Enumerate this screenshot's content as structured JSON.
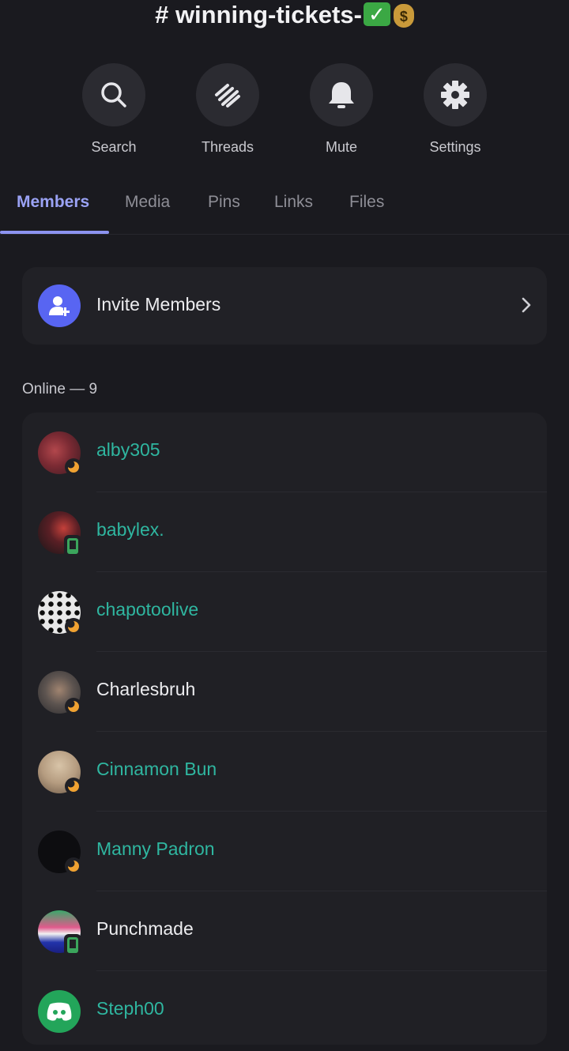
{
  "channel": {
    "title": "# winning-tickets-",
    "emoji_check": "✓",
    "emoji_bag": "$"
  },
  "actions": [
    {
      "label": "Search",
      "icon": "search-icon"
    },
    {
      "label": "Threads",
      "icon": "threads-icon"
    },
    {
      "label": "Mute",
      "icon": "bell-icon"
    },
    {
      "label": "Settings",
      "icon": "gear-icon"
    }
  ],
  "tabs": [
    {
      "label": "Members",
      "active": true
    },
    {
      "label": "Media",
      "active": false
    },
    {
      "label": "Pins",
      "active": false
    },
    {
      "label": "Links",
      "active": false
    },
    {
      "label": "Files",
      "active": false
    }
  ],
  "invite": {
    "label": "Invite Members",
    "icon": "add-user-icon"
  },
  "online_header": "Online — 9",
  "members": [
    {
      "name": "alby305",
      "color": "#2fb6a0",
      "status": "idle"
    },
    {
      "name": "babylex.",
      "color": "#2fb6a0",
      "status": "mobile"
    },
    {
      "name": "chapotoolive",
      "color": "#2fb6a0",
      "status": "idle"
    },
    {
      "name": "Charlesbruh",
      "color": "#ececef",
      "status": "idle"
    },
    {
      "name": "Cinnamon Bun",
      "color": "#2fb6a0",
      "status": "idle"
    },
    {
      "name": "Manny Padron",
      "color": "#2fb6a0",
      "status": "idle"
    },
    {
      "name": "Punchmade",
      "color": "#ececef",
      "status": "mobile"
    },
    {
      "name": "Steph00",
      "color": "#2fb6a0",
      "status": "online"
    }
  ],
  "colors": {
    "accent": "#5865f2",
    "tab_active": "#9aa2f4",
    "idle": "#f0a232",
    "mobile": "#3ba55c",
    "background": "#1a1a1f"
  }
}
